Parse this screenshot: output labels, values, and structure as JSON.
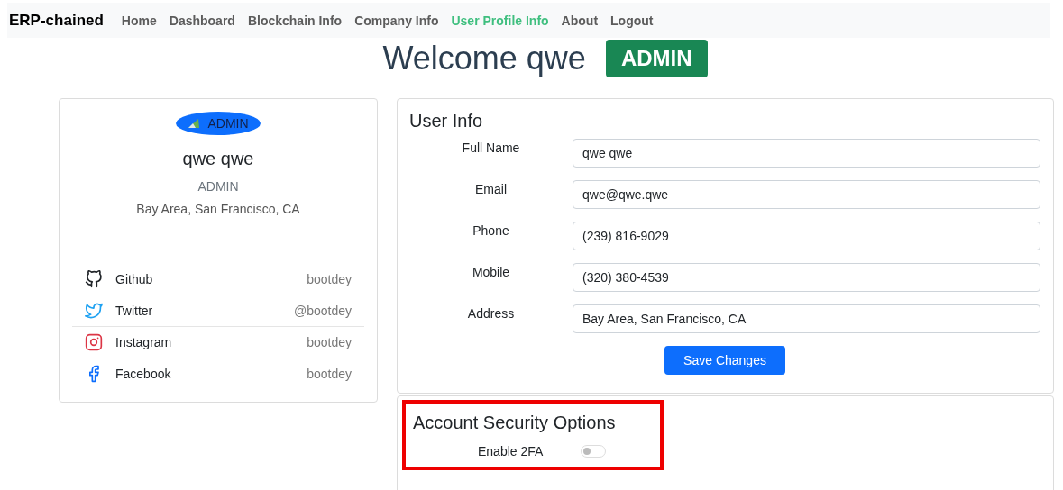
{
  "navbar": {
    "brand": "ERP-chained",
    "links": [
      {
        "label": "Home",
        "selected": false
      },
      {
        "label": "Dashboard",
        "selected": false
      },
      {
        "label": "Blockchain Info",
        "selected": false
      },
      {
        "label": "Company Info",
        "selected": false
      },
      {
        "label": "User Profile Info",
        "selected": true
      },
      {
        "label": "About",
        "selected": false
      },
      {
        "label": "Logout",
        "selected": false
      }
    ]
  },
  "welcome": {
    "title": "Welcome qwe",
    "role_badge": "ADMIN"
  },
  "profile_card": {
    "avatar_alt": "ADMIN",
    "name": "qwe qwe",
    "role": "ADMIN",
    "location": "Bay Area, San Francisco, CA",
    "social": [
      {
        "kind": "github",
        "label": "Github",
        "handle": "bootdey"
      },
      {
        "kind": "twitter",
        "label": "Twitter",
        "handle": "@bootdey"
      },
      {
        "kind": "instagram",
        "label": "Instagram",
        "handle": "bootdey"
      },
      {
        "kind": "facebook",
        "label": "Facebook",
        "handle": "bootdey"
      }
    ]
  },
  "user_info": {
    "title": "User Info",
    "fields": [
      {
        "label": "Full Name",
        "value": "qwe qwe"
      },
      {
        "label": "Email",
        "value": "qwe@qwe.qwe"
      },
      {
        "label": "Phone",
        "value": "(239) 816-9029"
      },
      {
        "label": "Mobile",
        "value": "(320) 380-4539"
      },
      {
        "label": "Address",
        "value": "Bay Area, San Francisco, CA"
      }
    ],
    "button": "Save Changes"
  },
  "security": {
    "title": "Account Security Options",
    "highlighted": true,
    "options": [
      {
        "label": "Enable 2FA",
        "on": false
      }
    ]
  }
}
